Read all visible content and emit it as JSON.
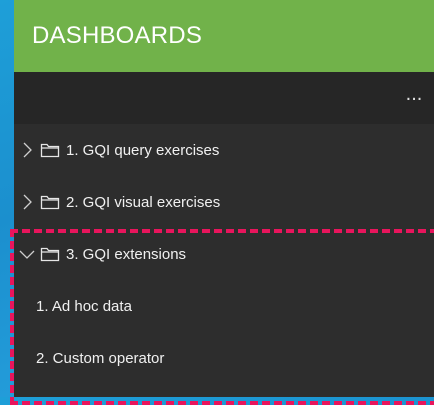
{
  "panel": {
    "title": "DASHBOARDS",
    "more_label": "..."
  },
  "tree": {
    "items": [
      {
        "label": "1. GQI query exercises",
        "type": "folder",
        "expanded": false,
        "icon": "folder-icon"
      },
      {
        "label": "2. GQI visual exercises",
        "type": "folder",
        "expanded": false,
        "icon": "folder-icon"
      },
      {
        "label": "3. GQI extensions",
        "type": "folder",
        "expanded": true,
        "icon": "folder-icon"
      },
      {
        "label": "1. Ad hoc data",
        "type": "dashboard"
      },
      {
        "label": "2. Custom operator",
        "type": "dashboard"
      }
    ]
  },
  "colors": {
    "header_bg": "#71b24a",
    "panel_bg": "#2d2d2d",
    "highlight": "#e8155c",
    "desktop_bg": "#1e9fd8"
  }
}
